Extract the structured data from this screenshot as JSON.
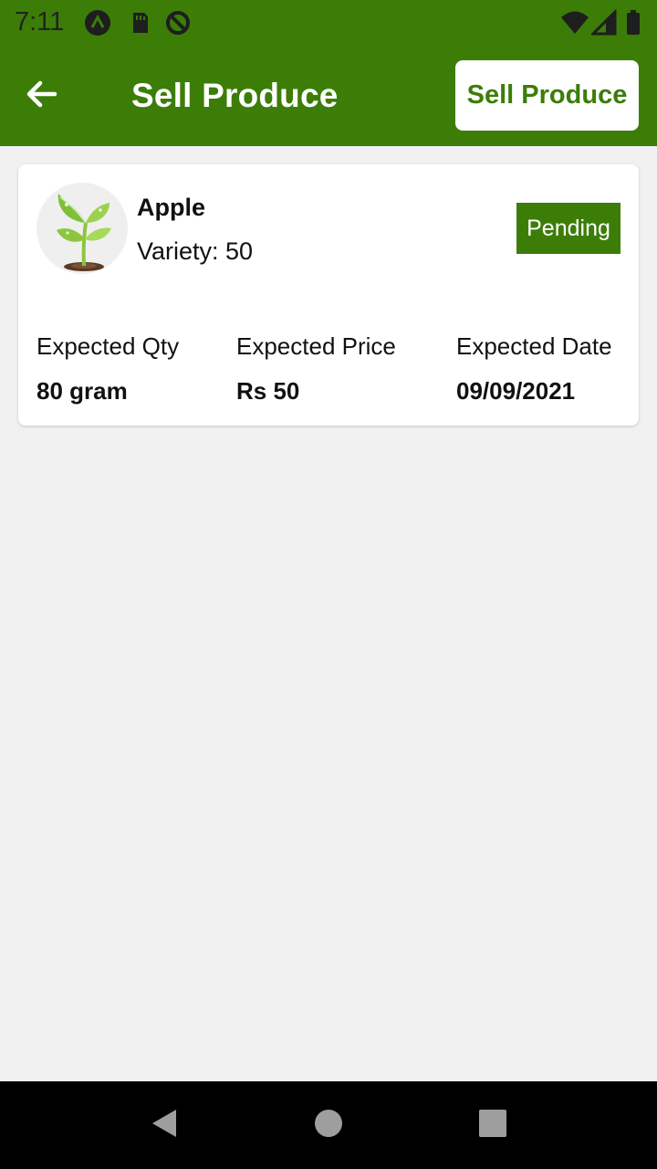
{
  "status_bar": {
    "time": "7:11",
    "icons": [
      "a-logo-icon",
      "sd-card-icon",
      "sync-off-icon",
      "wifi-icon",
      "cellular-icon",
      "battery-icon"
    ]
  },
  "app_bar": {
    "title": "Sell Produce",
    "action_label": "Sell Produce"
  },
  "colors": {
    "primary": "#3c7d08",
    "background": "#f1f1f1",
    "card": "#ffffff"
  },
  "listing": {
    "image_icon": "plant-sprout-icon",
    "name": "Apple",
    "variety_label": "Variety: ",
    "variety_value": "50",
    "status": "Pending",
    "fields": [
      {
        "label": "Expected Qty",
        "value": "80 gram"
      },
      {
        "label": "Expected Price",
        "value": "Rs 50"
      },
      {
        "label": "Expected Date",
        "value": "09/09/2021"
      }
    ]
  },
  "nav_bar": {
    "buttons": [
      "back-triangle-icon",
      "home-circle-icon",
      "recents-square-icon"
    ]
  }
}
